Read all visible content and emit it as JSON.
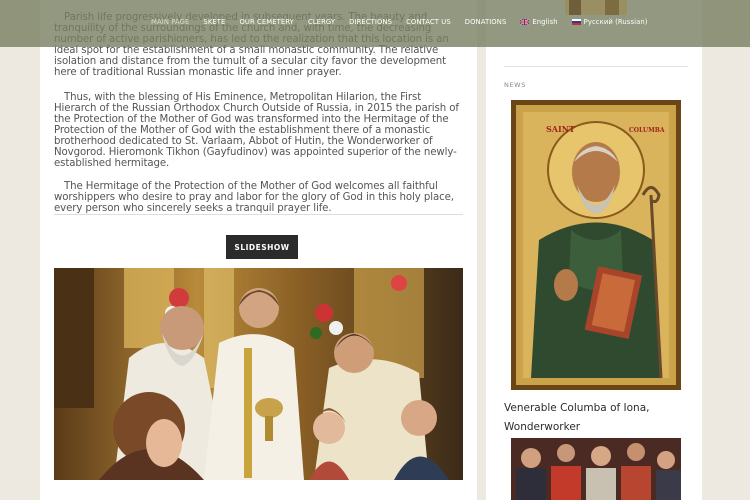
{
  "nav": {
    "items": [
      {
        "key": "main_page",
        "label": "MAIN PAGE",
        "active": true
      },
      {
        "key": "skete",
        "label": "SKETE",
        "active": false
      },
      {
        "key": "our_cemetery",
        "label": "OUR CEMETERY",
        "active": false
      },
      {
        "key": "clergy",
        "label": "CLERGY",
        "active": false
      },
      {
        "key": "directions",
        "label": "DIRECTIONS",
        "active": false
      },
      {
        "key": "contact_us",
        "label": "CONTACT US",
        "active": false
      },
      {
        "key": "donations",
        "label": "DONATIONS",
        "active": false
      }
    ],
    "languages": [
      {
        "label": "English",
        "flag": "uk-flag-icon"
      },
      {
        "label": "Русский (Russian)",
        "flag": "russia-flag-icon"
      }
    ]
  },
  "article": {
    "paragraphs": [
      "Parish life progressively developed in subsequent years. The beauty and tranquility of the surroundings of the church and, with time, the decreasing number of active parishioners, has led to the realization that this location is an ideal spot for the establishment of a small monastic community. The relative isolation and distance from the tumult of a secular city favor the development here of traditional Russian monastic life and inner prayer.",
      "Thus, with the blessing of His Eminence, Metropolitan Hilarion, the First Hierarch of the Russian Orthodox Church Outside of Russia, in 2015 the parish of the Protection of the Mother of God was transformed into the Hermitage of the Protection of the Mother of God with the establishment there of a monastic brotherhood dedicated to St. Varlaam, Abbot of Hutin, the Wonderworker of Novgorod. Hieromonk Tikhon (Gayfudinov) was appointed superior of the newly-established hermitage.",
      "The Hermitage of the Protection of the Mother of God welcomes all faithful worshippers who desire to pray and labor for the glory of God in this holy place, every person who sincerely seeks a tranquil prayer life."
    ],
    "slideshow_label": "SLIDESHOW"
  },
  "sidebar": {
    "news_label": "NEWS",
    "post_title": "Venerable Columba of Iona, Wonderworker",
    "icon_inscription": "SAINT COLUMBA"
  },
  "colors": {
    "navbar": "#787e60",
    "page_bg": "#ede9e1",
    "button": "#2b2b2b"
  }
}
